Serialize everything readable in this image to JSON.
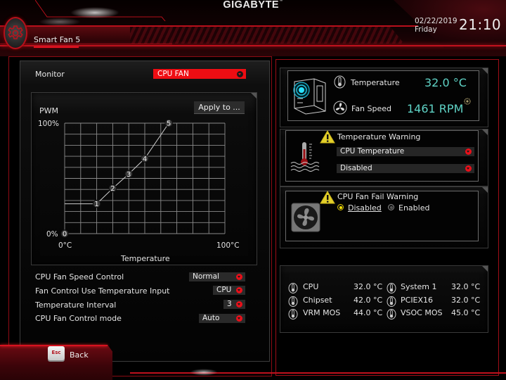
{
  "header": {
    "brand": "GIGABYTE",
    "brand_tm": "™",
    "tab_label": "Smart Fan 5",
    "date": "02/22/2019",
    "day": "Friday",
    "time": "21:10",
    "accent_color": "#e3121f"
  },
  "monitor": {
    "label": "Monitor",
    "selected": "CPU FAN"
  },
  "chart": {
    "apply_button": "Apply to ...",
    "ylabel": "PWM",
    "y_max_label": "100%",
    "y_min_label": "0%",
    "x_min_label": "0°C",
    "x_max_label": "100°C",
    "xlabel": "Temperature"
  },
  "chart_data": {
    "type": "line",
    "title": "",
    "xlabel": "Temperature",
    "ylabel": "PWM",
    "xlim": [
      0,
      100
    ],
    "ylim": [
      0,
      100
    ],
    "x_unit": "°C",
    "y_unit": "%",
    "grid": true,
    "grid_divisions": {
      "x": 10,
      "y": 10
    },
    "tick_labels": {
      "x": [
        "0°C",
        "100°C"
      ],
      "y": [
        "0%",
        "100%"
      ]
    },
    "series": [
      {
        "name": "CPU FAN curve",
        "points": [
          {
            "label": "0",
            "x": 0,
            "y": 0
          },
          {
            "label": "1",
            "x": 20,
            "y": 27
          },
          {
            "label": "2",
            "x": 30,
            "y": 41
          },
          {
            "label": "3",
            "x": 40,
            "y": 54
          },
          {
            "label": "4",
            "x": 50,
            "y": 68
          },
          {
            "label": "5",
            "x": 65,
            "y": 100
          }
        ],
        "floor_line_y": 27
      }
    ]
  },
  "settings": [
    {
      "label": "CPU Fan Speed Control",
      "value": "Normal"
    },
    {
      "label": "Fan Control Use Temperature Input",
      "value": "CPU"
    },
    {
      "label": "Temperature Interval",
      "value": "3"
    },
    {
      "label": "CPU Fan Control mode",
      "value": "Auto"
    }
  ],
  "back": {
    "key": "Esc",
    "label": "Back"
  },
  "status": {
    "temperature_label": "Temperature",
    "temperature_value": "32.0 °C",
    "fan_speed_label": "Fan Speed",
    "fan_speed_value": "1461 RPM",
    "value_color": "#5fd3c6"
  },
  "temperature_warning": {
    "title": "Temperature Warning",
    "source": "CPU Temperature",
    "threshold": "Disabled"
  },
  "fan_fail_warning": {
    "title": "CPU Fan Fail Warning",
    "options": [
      "Disabled",
      "Enabled"
    ],
    "selected": "Disabled"
  },
  "temperatures": [
    {
      "name": "CPU",
      "value": "32.0 °C"
    },
    {
      "name": "Chipset",
      "value": "42.0 °C"
    },
    {
      "name": "VRM MOS",
      "value": "44.0 °C"
    },
    {
      "name": "System 1",
      "value": "32.0 °C"
    },
    {
      "name": "PCIEX16",
      "value": "32.0 °C"
    },
    {
      "name": "VSOC MOS",
      "value": "45.0 °C"
    }
  ]
}
